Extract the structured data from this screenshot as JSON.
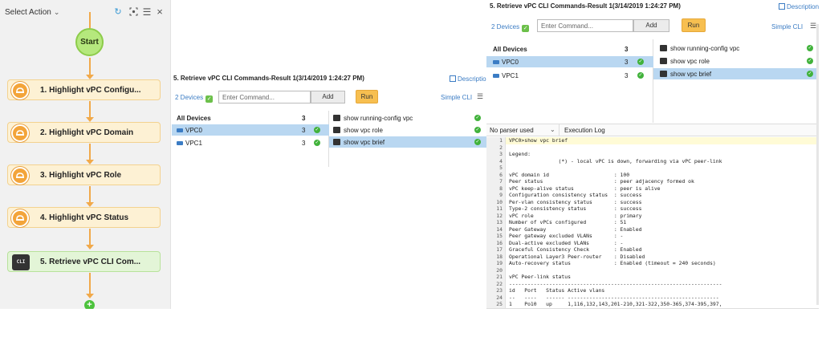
{
  "flow": {
    "select_action": "Select Action",
    "start_label": "Start",
    "steps": [
      {
        "label": "1. Highlight vPC Configu..."
      },
      {
        "label": "2. Highlight vPC Domain"
      },
      {
        "label": "3. Highlight vPC Role"
      },
      {
        "label": "4. Highlight vPC Status"
      },
      {
        "label": "5. Retrieve vPC CLI Com..."
      }
    ],
    "cli_icon_text": "CLI"
  },
  "result_small": {
    "title": "5. Retrieve vPC CLI Commands-Result 1(3/14/2019 1:24:27 PM)",
    "description": "Description",
    "devices_link": "2 Devices",
    "command_placeholder": "Enter Command...",
    "add_label": "Add",
    "run_label": "Run",
    "simple_cli": "Simple CLI",
    "all_devices_label": "All Devices",
    "all_devices_count": "3",
    "devices": [
      {
        "name": "VPC0",
        "count": "3"
      },
      {
        "name": "VPC1",
        "count": "3"
      }
    ],
    "commands": [
      {
        "text": "show running-config vpc"
      },
      {
        "text": "show vpc role"
      },
      {
        "text": "show vpc brief"
      }
    ]
  },
  "result_large": {
    "title": "5. Retrieve vPC CLI Commands-Result 1(3/14/2019 1:24:27 PM)",
    "description": "Description",
    "devices_link": "2 Devices",
    "command_placeholder": "Enter Command...",
    "add_label": "Add",
    "run_label": "Run",
    "simple_cli": "Simple CLI",
    "all_devices_label": "All Devices",
    "all_devices_count": "3",
    "devices": [
      {
        "name": "VPC0",
        "count": "3"
      },
      {
        "name": "VPC1",
        "count": "3"
      }
    ],
    "commands": [
      {
        "text": "show running-config vpc"
      },
      {
        "text": "show vpc role"
      },
      {
        "text": "show vpc brief"
      }
    ]
  },
  "log": {
    "parser_label": "No parser used",
    "execution_log": "Execution Log",
    "lines": [
      {
        "n": "1",
        "text": "VPC0>show vpc brief"
      },
      {
        "n": "2",
        "text": ""
      },
      {
        "n": "3",
        "text": "Legend:"
      },
      {
        "n": "4",
        "text": "                (*) - local vPC is down, forwarding via vPC peer-link"
      },
      {
        "n": "5",
        "text": ""
      },
      {
        "n": "6",
        "text": "vPC domain id                     : 100"
      },
      {
        "n": "7",
        "text": "Peer status                       : peer adjacency formed ok"
      },
      {
        "n": "8",
        "text": "vPC keep-alive status             : peer is alive"
      },
      {
        "n": "9",
        "text": "Configuration consistency status  : success"
      },
      {
        "n": "10",
        "text": "Per-vlan consistency status       : success"
      },
      {
        "n": "11",
        "text": "Type-2 consistency status         : success"
      },
      {
        "n": "12",
        "text": "vPC role                          : primary"
      },
      {
        "n": "13",
        "text": "Number of vPCs configured         : 51"
      },
      {
        "n": "14",
        "text": "Peer Gateway                      : Enabled"
      },
      {
        "n": "15",
        "text": "Peer gateway excluded VLANs       : -"
      },
      {
        "n": "16",
        "text": "Dual-active excluded VLANs        : -"
      },
      {
        "n": "17",
        "text": "Graceful Consistency Check        : Enabled"
      },
      {
        "n": "18",
        "text": "Operational Layer3 Peer-router    : Disabled"
      },
      {
        "n": "19",
        "text": "Auto-recovery status              : Enabled (timeout = 240 seconds)"
      },
      {
        "n": "20",
        "text": ""
      },
      {
        "n": "21",
        "text": "vPC Peer-link status"
      },
      {
        "n": "22",
        "text": "---------------------------------------------------------------------"
      },
      {
        "n": "23",
        "text": "id   Port   Status Active vlans"
      },
      {
        "n": "24",
        "text": "--   ----   ------ -------------------------------------------------"
      },
      {
        "n": "25",
        "text": "1    Po10   up     1,116,132,143,201-210,321-322,350-365,374-395,397,"
      }
    ]
  }
}
